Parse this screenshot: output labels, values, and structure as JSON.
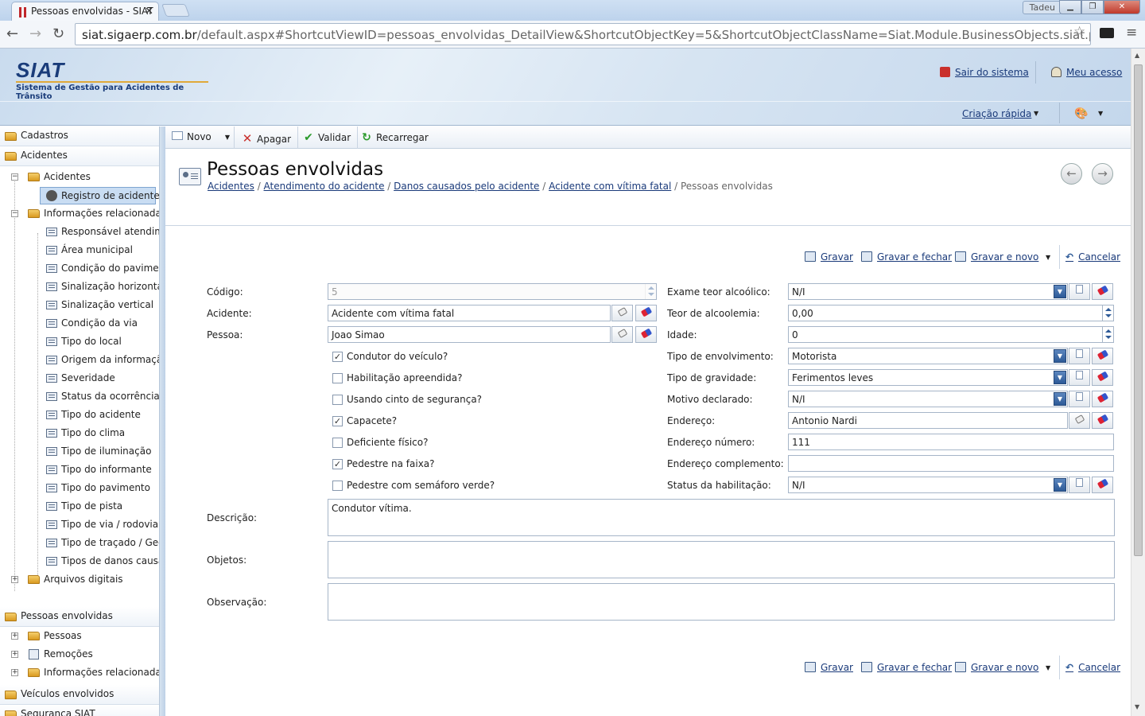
{
  "browser": {
    "tab_title": "Pessoas envolvidas - SIAT",
    "user_badge": "Tadeu",
    "url_host": "siat.sigaerp.com.br",
    "url_rest": "/default.aspx#ShortcutViewID=pessoas_envolvidas_DetailView&ShortcutObjectKey=5&ShortcutObjectClassName=Siat.Module.BusinessObjects.siat.pessoas"
  },
  "header": {
    "logo": "SIAT",
    "subtitle": "Sistema de Gestão para Acidentes de Trânsito",
    "logout": "Sair do sistema",
    "my_access": "Meu acesso",
    "quick_create": "Criação rápida"
  },
  "sidebar": {
    "groups": {
      "cadastros": "Cadastros",
      "acidentes": "Acidentes",
      "pessoas": "Pessoas envolvidas",
      "veiculos": "Veículos envolvidos",
      "seguranca": "Segurança SIAT"
    },
    "acidentes_node": "Acidentes",
    "registro": "Registro de acidentes",
    "info_node": "Informações relacionadas",
    "info_items": [
      "Responsável atendimento",
      "Área municipal",
      "Condição do pavimento",
      "Sinalização horizontal",
      "Sinalização vertical",
      "Condição da via",
      "Tipo do local",
      "Origem da informação",
      "Severidade",
      "Status da ocorrência",
      "Tipo do acidente",
      "Tipo do clima",
      "Tipo de iluminação",
      "Tipo do informante",
      "Tipo do pavimento",
      "Tipo de pista",
      "Tipo de via / rodovia",
      "Tipo de traçado / Geometria",
      "Tipos de danos causados"
    ],
    "arquivos": "Arquivos digitais",
    "pessoas_items": [
      "Pessoas",
      "Remoções",
      "Informações relacionadas"
    ]
  },
  "toolbar": {
    "novo": "Novo",
    "apagar": "Apagar",
    "validar": "Validar",
    "recarregar": "Recarregar"
  },
  "view": {
    "title": "Pessoas envolvidas",
    "crumbs": [
      "Acidentes",
      "Atendimento do acidente",
      "Danos causados pelo acidente",
      "Acidente com vítima fatal"
    ],
    "crumb_current": "Pessoas envolvidas"
  },
  "actions": {
    "gravar": "Gravar",
    "gravar_fechar": "Gravar e fechar",
    "gravar_novo": "Gravar e novo",
    "cancelar": "Cancelar"
  },
  "form": {
    "codigo_label": "Código:",
    "codigo": "5",
    "acidente_label": "Acidente:",
    "acidente": "Acidente com vítima fatal",
    "pessoa_label": "Pessoa:",
    "pessoa": "Joao Simao",
    "checks": [
      {
        "label": "Condutor do veículo?",
        "checked": true
      },
      {
        "label": "Habilitação apreendida?",
        "checked": false
      },
      {
        "label": "Usando cinto de segurança?",
        "checked": false
      },
      {
        "label": "Capacete?",
        "checked": true
      },
      {
        "label": "Deficiente físico?",
        "checked": false
      },
      {
        "label": "Pedestre na faixa?",
        "checked": true
      },
      {
        "label": "Pedestre com semáforo verde?",
        "checked": false
      }
    ],
    "exame_label": "Exame teor alcoólico:",
    "exame": "N/I",
    "teor_label": "Teor de alcoolemia:",
    "teor": "0,00",
    "idade_label": "Idade:",
    "idade": "0",
    "envolvimento_label": "Tipo de envolvimento:",
    "envolvimento": "Motorista",
    "gravidade_label": "Tipo de gravidade:",
    "gravidade": "Ferimentos leves",
    "motivo_label": "Motivo declarado:",
    "motivo": "N/I",
    "endereco_label": "Endereço:",
    "endereco": "Antonio Nardi",
    "numero_label": "Endereço número:",
    "numero": "111",
    "complemento_label": "Endereço complemento:",
    "complemento": "",
    "status_label": "Status da habilitação:",
    "status": "N/I",
    "descricao_label": "Descrição:",
    "descricao": "Condutor vítima.",
    "objetos_label": "Objetos:",
    "objetos": "",
    "observacao_label": "Observação:",
    "observacao": ""
  }
}
